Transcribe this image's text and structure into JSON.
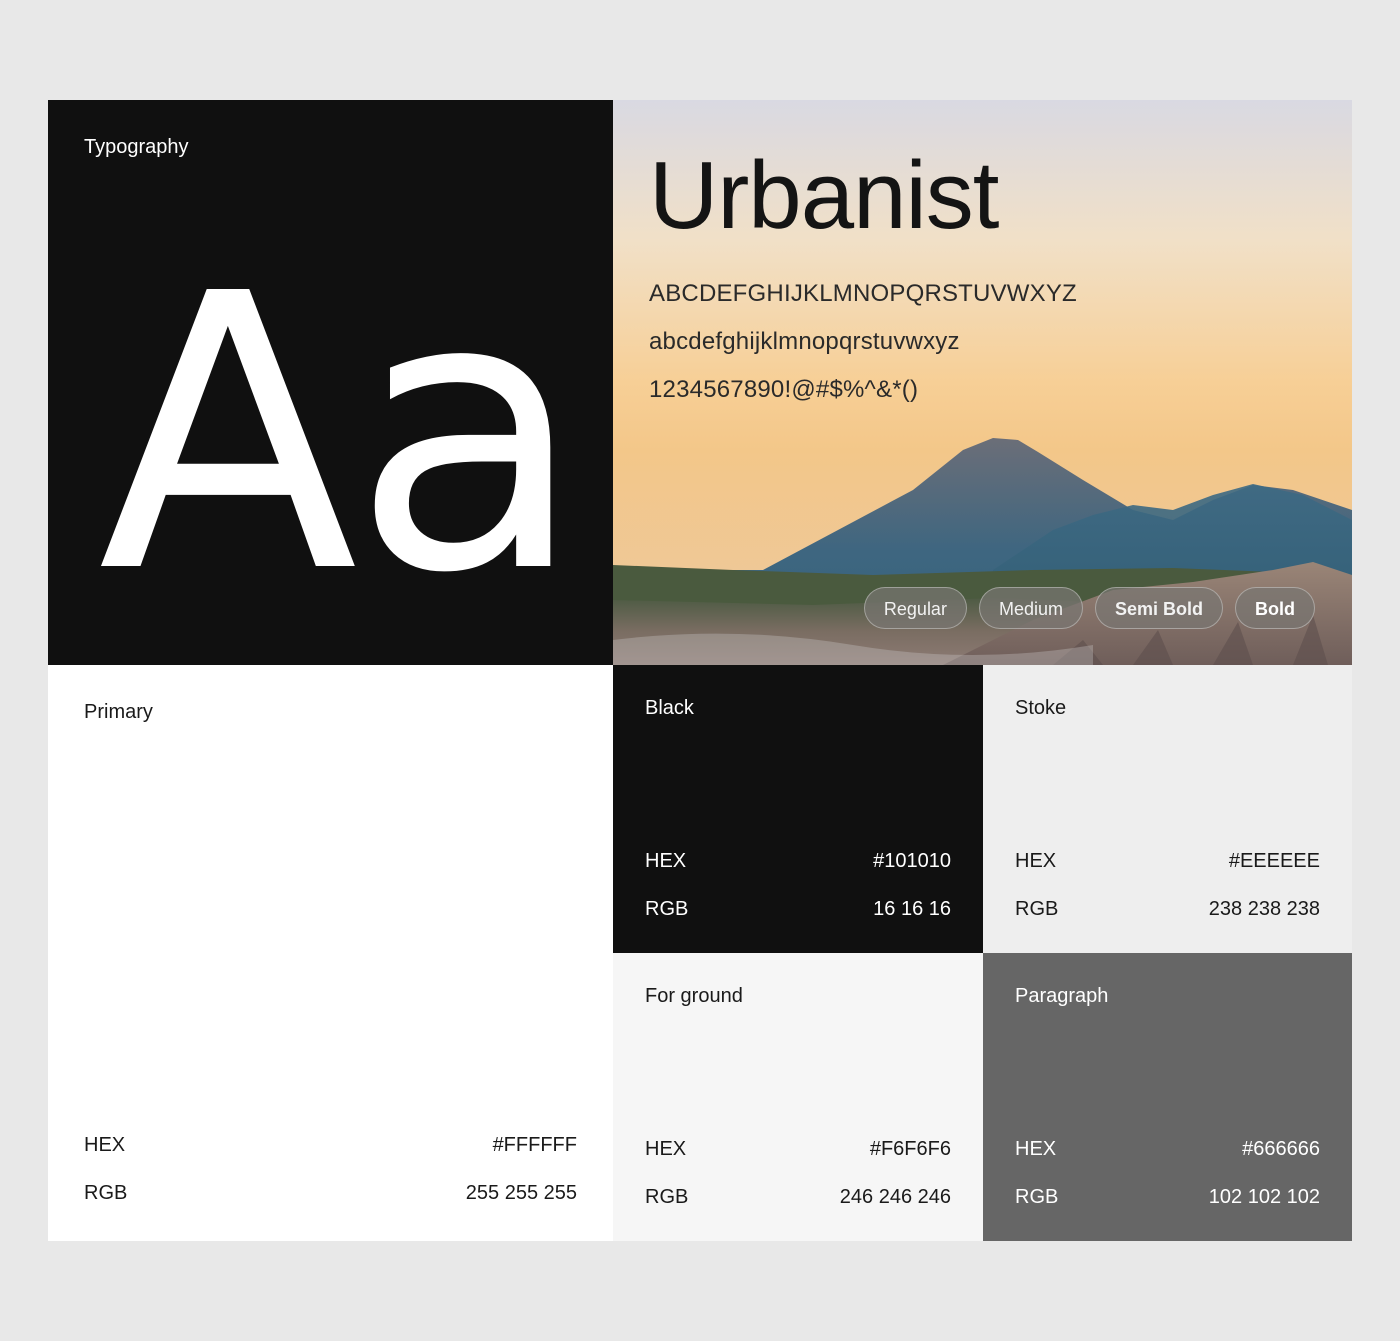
{
  "typography": {
    "label": "Typography",
    "specimen": "Aa"
  },
  "font": {
    "name": "Urbanist",
    "uppercase": "ABCDEFGHIJKLMNOPQRSTUVWXYZ",
    "lowercase": "abcdefghijklmnopqrstuvwxyz",
    "numerals": "1234567890!@#$%^&*()",
    "weights": [
      "Regular",
      "Medium",
      "Semi Bold",
      "Bold"
    ]
  },
  "colors": {
    "hex_label": "HEX",
    "rgb_label": "RGB",
    "swatches": [
      {
        "name": "Primary",
        "hex": "#FFFFFF",
        "rgb": "255 255 255"
      },
      {
        "name": "Black",
        "hex": "#101010",
        "rgb": "16 16 16"
      },
      {
        "name": "Stoke",
        "hex": "#EEEEEE",
        "rgb": "238 238 238"
      },
      {
        "name": "For ground",
        "hex": "#F6F6F6",
        "rgb": "246 246 246"
      },
      {
        "name": "Paragraph",
        "hex": "#666666",
        "rgb": "102 102 102"
      }
    ]
  },
  "page_background": "#e8e8e8"
}
